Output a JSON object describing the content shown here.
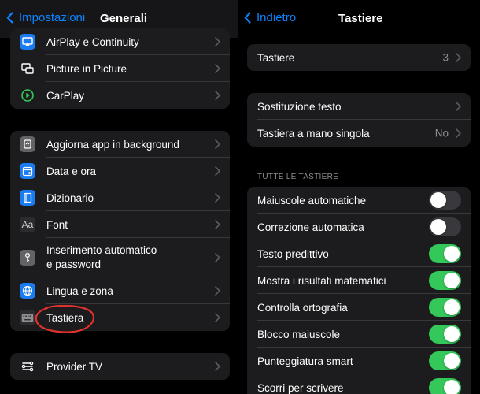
{
  "left_panel": {
    "back_label": "Impostazioni",
    "title": "Generali",
    "group1": [
      {
        "label": "AirPlay e Continuity",
        "icon": "airplay-icon"
      },
      {
        "label": "Picture in Picture",
        "icon": "picture-in-picture-icon"
      },
      {
        "label": "CarPlay",
        "icon": "carplay-icon"
      }
    ],
    "group2": [
      {
        "label": "Aggiorna app in background",
        "icon": "background-refresh-icon"
      },
      {
        "label": "Data e ora",
        "icon": "calendar-icon"
      },
      {
        "label": "Dizionario",
        "icon": "dictionary-icon"
      },
      {
        "label": "Font",
        "icon": "font-icon",
        "icon_text": "Aa"
      },
      {
        "label": "Inserimento automatico e password",
        "label_line1": "Inserimento automatico",
        "label_line2": "e password",
        "icon": "key-icon"
      },
      {
        "label": "Lingua e zona",
        "icon": "globe-icon"
      },
      {
        "label": "Tastiera",
        "icon": "keyboard-icon"
      }
    ],
    "group3": [
      {
        "label": "Provider TV",
        "icon": "tv-provider-icon"
      }
    ]
  },
  "right_panel": {
    "back_label": "Indietro",
    "title": "Tastiere",
    "keyboards_row": {
      "label": "Tastiere",
      "value": "3"
    },
    "group2": [
      {
        "label": "Sostituzione testo",
        "value": ""
      },
      {
        "label": "Tastiera a mano singola",
        "value": "No"
      }
    ],
    "section_header": "TUTTE LE TASTIERE",
    "toggles": [
      {
        "label": "Maiuscole automatiche",
        "on": false
      },
      {
        "label": "Correzione automatica",
        "on": false
      },
      {
        "label": "Testo predittivo",
        "on": true
      },
      {
        "label": "Mostra i risultati matematici",
        "on": true
      },
      {
        "label": "Controlla ortografia",
        "on": true
      },
      {
        "label": "Blocco maiuscole",
        "on": true
      },
      {
        "label": "Punteggiatura smart",
        "on": true
      },
      {
        "label": "Scorri per scrivere",
        "on": true
      }
    ]
  },
  "colors": {
    "accent_blue": "#0a84ff",
    "toggle_on": "#34c759",
    "toggle_off": "#39393d",
    "group_bg": "#1c1c1e",
    "annotation_red": "#e0322d"
  }
}
